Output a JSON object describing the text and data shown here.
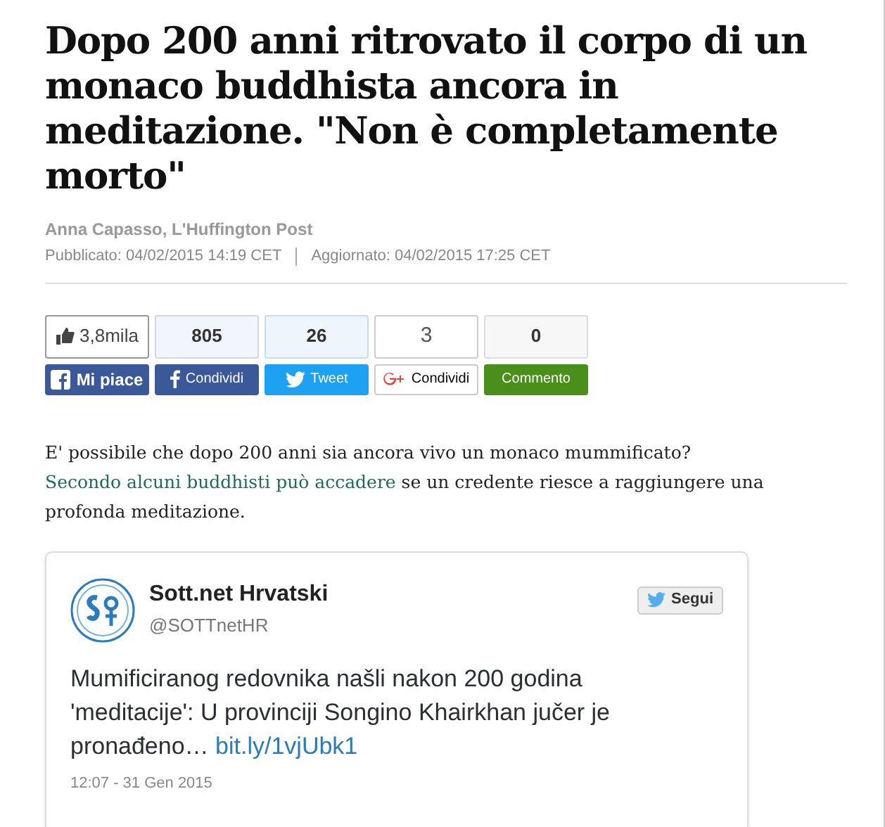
{
  "headline": "Dopo 200 anni ritrovato il corpo di un monaco buddhista ancora in meditazione. \"Non è completamente morto\"",
  "byline": "Anna Capasso, L'Huffington Post",
  "published": "Pubblicato: 04/02/2015 14:19 CET",
  "updated": "Aggiornato: 04/02/2015 17:25 CET",
  "social": [
    {
      "kind": "facebook-like",
      "count": "3,8mila",
      "label": "Mi piace"
    },
    {
      "kind": "facebook-share",
      "count": "805",
      "label": "Condividi"
    },
    {
      "kind": "twitter",
      "count": "26",
      "label": "Tweet"
    },
    {
      "kind": "google",
      "count": "3",
      "label": "Condividi"
    },
    {
      "kind": "comment",
      "count": "0",
      "label": "Commento"
    }
  ],
  "paragraph": [
    {
      "text": "E' possibile che dopo 200 anni sia ancora vivo un monaco mummificato? ",
      "link": false
    },
    {
      "text": "Secondo ",
      "link": true
    },
    {
      "text": "alcuni buddhisti può accadere",
      "link": true
    },
    {
      "text": " se un credente riesce a raggiungere una profonda meditazione.",
      "link": false
    }
  ],
  "tweet": {
    "name": "Sott.net Hrvatski",
    "handle": "@SOTTnetHR",
    "follow": "Segui",
    "text": "Mumificiranog redovnika našli nakon 200 godina 'meditacije': U provinciji Songino Khairkhan jučer je pronađeno… ",
    "link": "bit.ly/1vjUbk1",
    "time": "12:07 - 31 Gen 2015"
  }
}
